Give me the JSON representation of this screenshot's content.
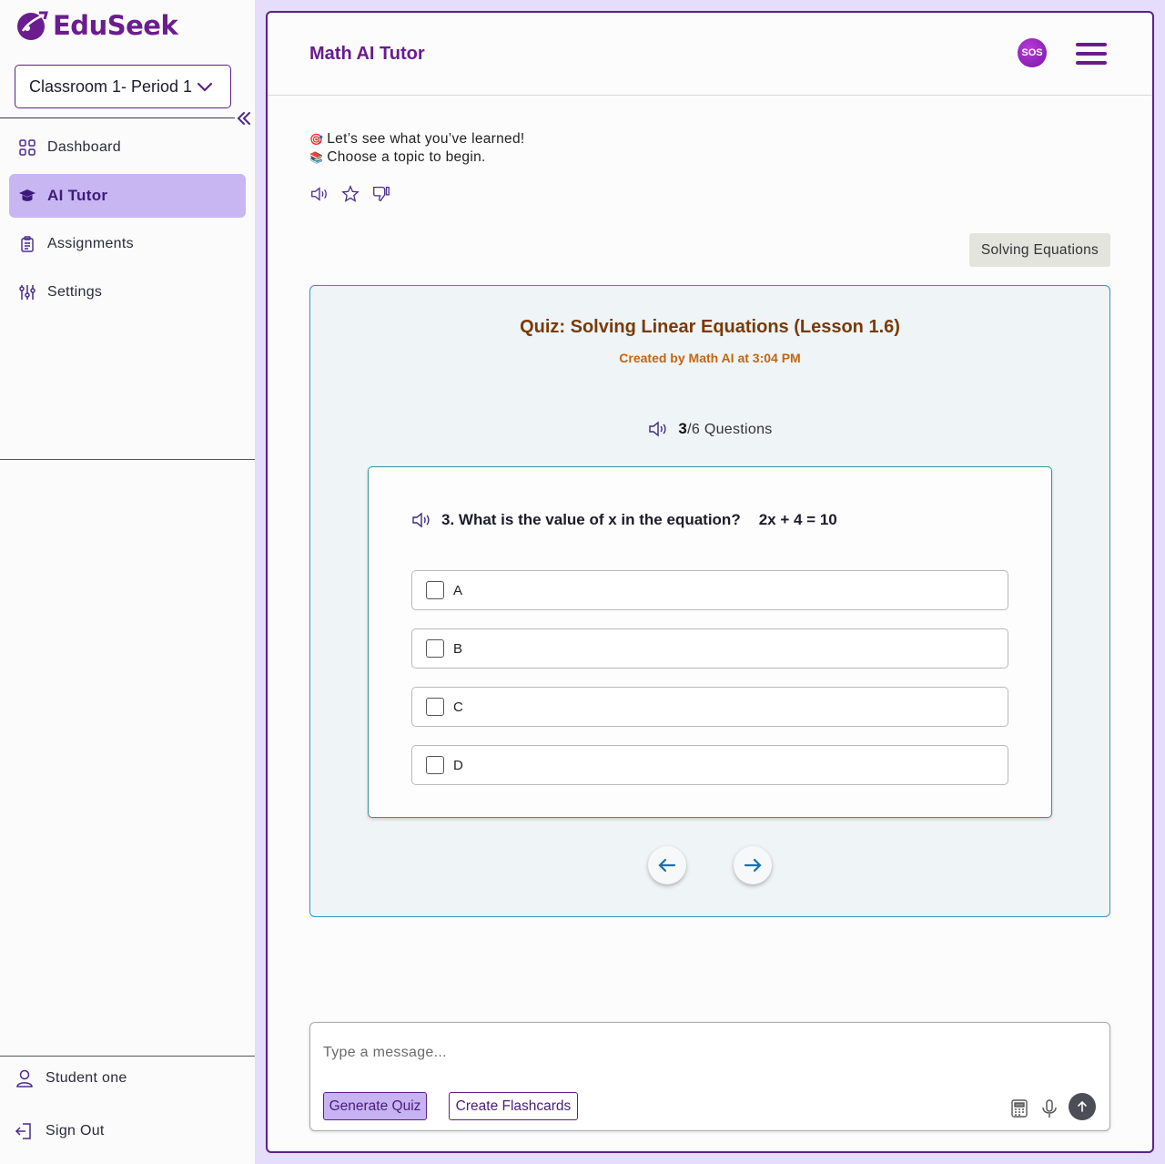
{
  "brand": {
    "name": "EduSeek",
    "color": "#6b1c8f"
  },
  "classroom_selector": {
    "value": "Classroom 1- Period 1"
  },
  "sidebar": {
    "items": [
      {
        "label": "Dashboard",
        "icon": "grid-icon"
      },
      {
        "label": "AI Tutor",
        "icon": "graduation-cap-icon",
        "active": true
      },
      {
        "label": "Assignments",
        "icon": "clipboard-icon"
      },
      {
        "label": "Settings",
        "icon": "sliders-icon"
      }
    ],
    "user_name": "Student one",
    "sign_out_label": "Sign Out"
  },
  "header": {
    "title": "Math AI Tutor",
    "sos_label": "SOS"
  },
  "intro_message": {
    "line1": "Let’s see what you’ve learned!",
    "line2": "Choose a topic to begin."
  },
  "topic_chip": "Solving Equations",
  "quiz": {
    "title": "Quiz: Solving Linear Equations (Lesson 1.6)",
    "subtitle": "Created by Math AI at 3:04 PM",
    "current": "3",
    "total_text": "/6 Questions",
    "question": "3. What is the value of x in the equation?",
    "equation": "2x + 4 = 10",
    "options": [
      "A",
      "B",
      "C",
      "D"
    ]
  },
  "composer": {
    "placeholder": "Type a message...",
    "generate_quiz_label": "Generate Quiz",
    "create_flashcards_label": "Create Flashcards"
  },
  "colors": {
    "accent": "#6a1b8e",
    "quiz_border": "#3a8fc4",
    "quiz_title": "#7a3a08",
    "quiz_subtitle": "#c4650f",
    "active_nav": "#c8b6f3"
  }
}
